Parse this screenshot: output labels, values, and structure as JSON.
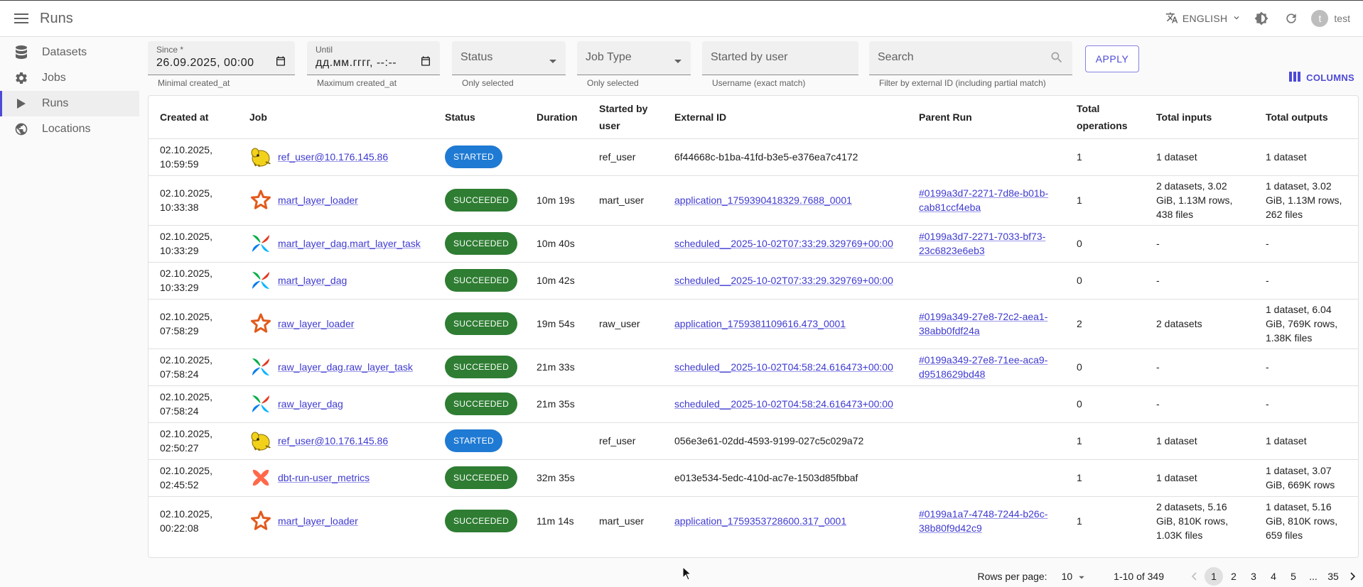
{
  "app": {
    "title": "Runs"
  },
  "header": {
    "language": "ENGLISH",
    "user_initial": "t",
    "user_name": "test"
  },
  "sidebar": {
    "items": [
      {
        "label": "Datasets",
        "icon": "database-icon",
        "active": false
      },
      {
        "label": "Jobs",
        "icon": "gear-icon",
        "active": false
      },
      {
        "label": "Runs",
        "icon": "play-icon",
        "active": true
      },
      {
        "label": "Locations",
        "icon": "globe-icon",
        "active": false
      }
    ]
  },
  "filters": {
    "since": {
      "label": "Since *",
      "value": "26.09.2025, 00:00",
      "helper": "Minimal created_at"
    },
    "until": {
      "label": "Until",
      "value": "дд.мм.гггг, --:--",
      "helper": "Maximum created_at"
    },
    "status": {
      "placeholder": "Status",
      "helper": "Only selected"
    },
    "job_type": {
      "placeholder": "Job Type",
      "helper": "Only selected"
    },
    "started_by": {
      "placeholder": "Started by user",
      "helper": "Username (exact match)"
    },
    "search": {
      "placeholder": "Search",
      "helper": "Filter by external ID (including partial match)"
    },
    "apply_label": "APPLY",
    "columns_label": "COLUMNS"
  },
  "table": {
    "columns": [
      "Created at",
      "Job",
      "Status",
      "Duration",
      "Started by user",
      "External ID",
      "Parent Run",
      "Total operations",
      "Total inputs",
      "Total outputs"
    ],
    "rows": [
      {
        "created": "02.10.2025, 10:59:59",
        "job_icon": "hadoop-icon",
        "job": "ref_user@10.176.145.86",
        "status": "STARTED",
        "status_kind": "started",
        "duration": "",
        "started_by": "ref_user",
        "external_id": "6f44668c-b1ba-41fd-b3e5-e376ea7c4172",
        "external_link": false,
        "parent": "",
        "ops": "1",
        "inputs": "1 dataset",
        "outputs": "1 dataset"
      },
      {
        "created": "02.10.2025, 10:33:38",
        "job_icon": "spark-icon",
        "job": "mart_layer_loader",
        "status": "SUCCEEDED",
        "status_kind": "succeeded",
        "duration": "10m 19s",
        "started_by": "mart_user",
        "external_id": "application_1759390418329.7688_0001",
        "external_link": true,
        "parent": "#0199a3d7-2271-7d8e-b01b-cab81ccf4eba",
        "ops": "1",
        "inputs": "2 datasets, 3.02 GiB, 1.13M rows, 438 files",
        "outputs": "1 dataset, 3.02 GiB, 1.13M rows, 262 files"
      },
      {
        "created": "02.10.2025, 10:33:29",
        "job_icon": "airflow-icon",
        "job": "mart_layer_dag.mart_layer_task",
        "status": "SUCCEEDED",
        "status_kind": "succeeded",
        "duration": "10m 40s",
        "started_by": "",
        "external_id": "scheduled__2025-10-02T07:33:29.329769+00:00",
        "external_link": true,
        "parent": "#0199a3d7-2271-7033-bf73-23c6823e6eb3",
        "ops": "0",
        "inputs": "-",
        "outputs": "-"
      },
      {
        "created": "02.10.2025, 10:33:29",
        "job_icon": "airflow-icon",
        "job": "mart_layer_dag",
        "status": "SUCCEEDED",
        "status_kind": "succeeded",
        "duration": "10m 42s",
        "started_by": "",
        "external_id": "scheduled__2025-10-02T07:33:29.329769+00:00",
        "external_link": true,
        "parent": "",
        "ops": "0",
        "inputs": "-",
        "outputs": "-"
      },
      {
        "created": "02.10.2025, 07:58:29",
        "job_icon": "spark-icon",
        "job": "raw_layer_loader",
        "status": "SUCCEEDED",
        "status_kind": "succeeded",
        "duration": "19m 54s",
        "started_by": "raw_user",
        "external_id": "application_1759381109616.473_0001",
        "external_link": true,
        "parent": "#0199a349-27e8-72c2-aea1-38abb0fdf24a",
        "ops": "2",
        "inputs": "2 datasets",
        "outputs": "1 dataset, 6.04 GiB, 769K rows, 1.38K files"
      },
      {
        "created": "02.10.2025, 07:58:24",
        "job_icon": "airflow-icon",
        "job": "raw_layer_dag.raw_layer_task",
        "status": "SUCCEEDED",
        "status_kind": "succeeded",
        "duration": "21m 33s",
        "started_by": "",
        "external_id": "scheduled__2025-10-02T04:58:24.616473+00:00",
        "external_link": true,
        "parent": "#0199a349-27e8-71ee-aca9-d9518629bd48",
        "ops": "0",
        "inputs": "-",
        "outputs": "-"
      },
      {
        "created": "02.10.2025, 07:58:24",
        "job_icon": "airflow-icon",
        "job": "raw_layer_dag",
        "status": "SUCCEEDED",
        "status_kind": "succeeded",
        "duration": "21m 35s",
        "started_by": "",
        "external_id": "scheduled__2025-10-02T04:58:24.616473+00:00",
        "external_link": true,
        "parent": "",
        "ops": "0",
        "inputs": "-",
        "outputs": "-"
      },
      {
        "created": "02.10.2025, 02:50:27",
        "job_icon": "hadoop-icon",
        "job": "ref_user@10.176.145.86",
        "status": "STARTED",
        "status_kind": "started",
        "duration": "",
        "started_by": "ref_user",
        "external_id": "056e3e61-02dd-4593-9199-027c5c029a72",
        "external_link": false,
        "parent": "",
        "ops": "1",
        "inputs": "1 dataset",
        "outputs": "1 dataset"
      },
      {
        "created": "02.10.2025, 02:45:52",
        "job_icon": "dbt-icon",
        "job": "dbt-run-user_metrics",
        "status": "SUCCEEDED",
        "status_kind": "succeeded",
        "duration": "32m 35s",
        "started_by": "",
        "external_id": "e013e534-5edc-410d-ac7e-1503d85fbbaf",
        "external_link": false,
        "parent": "",
        "ops": "1",
        "inputs": "1 dataset",
        "outputs": "1 dataset, 3.07 GiB, 669K rows"
      },
      {
        "created": "02.10.2025, 00:22:08",
        "job_icon": "spark-icon",
        "job": "mart_layer_loader",
        "status": "SUCCEEDED",
        "status_kind": "succeeded",
        "duration": "11m 14s",
        "started_by": "mart_user",
        "external_id": "application_1759353728600.317_0001",
        "external_link": true,
        "parent": "#0199a1a7-4748-7244-b26c-38b80f9d42c9",
        "ops": "1",
        "inputs": "2 datasets, 5.16 GiB, 810K rows, 1.03K files",
        "outputs": "1 dataset, 5.16 GiB, 810K rows, 659 files"
      }
    ]
  },
  "pagination": {
    "rows_per_page_label": "Rows per page:",
    "rows_per_page": "10",
    "range": "1-10 of 349",
    "pages": [
      "1",
      "2",
      "3",
      "4",
      "5",
      "...",
      "35"
    ],
    "current_page": "1"
  },
  "colors": {
    "accent": "#4e4ad6",
    "started": "#1f7ad3",
    "succeeded": "#2e7d32"
  }
}
